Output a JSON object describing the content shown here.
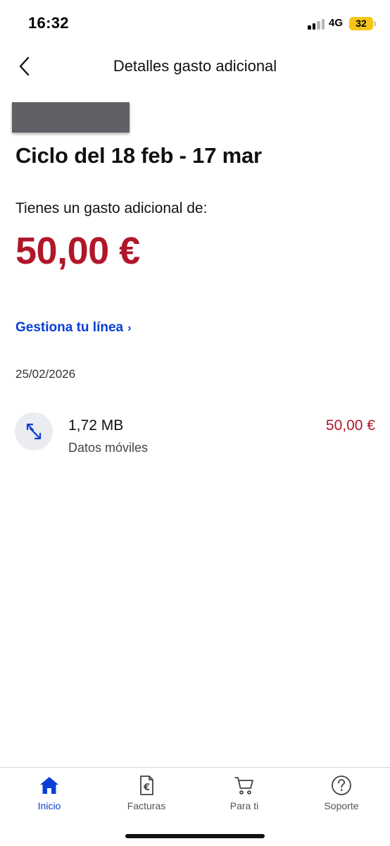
{
  "status_bar": {
    "time": "16:32",
    "network": "4G",
    "battery": "32",
    "battery_color": "#f5c518"
  },
  "header": {
    "title": "Detalles gasto adicional",
    "back_icon": "chevron-left-icon"
  },
  "cycle": {
    "title": "Ciclo del 18 feb - 17 mar"
  },
  "summary": {
    "label": "Tienes un gasto adicional de:",
    "amount": "50,00 €",
    "amount_color": "#b0172a"
  },
  "manage_link": {
    "label": "Gestiona tu línea",
    "chevron": "›",
    "color": "#0a3fd6"
  },
  "charges": {
    "date": "25/02/2026",
    "items": [
      {
        "icon": "data-transfer-icon",
        "usage": "1,72 MB",
        "type": "Datos móviles",
        "price": "50,00 €"
      }
    ]
  },
  "bottom_nav": {
    "items": [
      {
        "label": "Inicio",
        "icon": "home-icon",
        "active": true
      },
      {
        "label": "Facturas",
        "icon": "invoice-euro-icon",
        "active": false
      },
      {
        "label": "Para ti",
        "icon": "cart-icon",
        "active": false
      },
      {
        "label": "Soporte",
        "icon": "help-icon",
        "active": false
      }
    ],
    "active_color": "#0a3fd6"
  }
}
